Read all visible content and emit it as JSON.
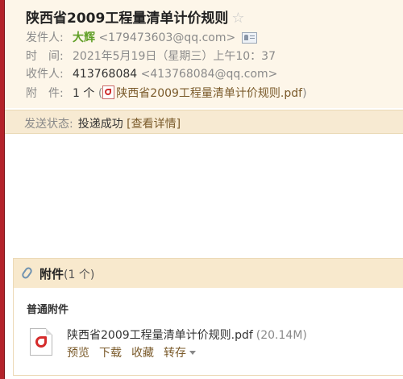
{
  "email": {
    "subject": "陕西省2009工程量清单计价规则",
    "star_icon": "star-icon",
    "from": {
      "label": "发件人:",
      "name": "大辉",
      "address": "<179473603@qq.com>"
    },
    "time": {
      "label": "时　间:",
      "value": "2021年5月19日（星期三）上午10：37"
    },
    "to": {
      "label": "收件人:",
      "name": "413768084",
      "address": "<413768084@qq.com>"
    },
    "attachment_line": {
      "label": "附　件:",
      "count": "1 个",
      "open": "(",
      "file": "陕西省2009工程量清单计价规则.pdf",
      "close": ")"
    }
  },
  "status": {
    "label": "发送状态:",
    "value": "投递成功",
    "link": "[查看详情]"
  },
  "attachments": {
    "title": "附件",
    "count": "(1 个)",
    "section": "普通附件",
    "files": [
      {
        "name": "陕西省2009工程量清单计价规则.pdf",
        "size": "(20.14M)",
        "actions": {
          "preview": "预览",
          "download": "下载",
          "favorite": "收藏",
          "forward": "转存"
        }
      }
    ]
  },
  "colors": {
    "accent_bar": "#b3222a",
    "header_bg": "#fdf6e9",
    "status_bg": "#f7ead2",
    "link": "#7a5a2a",
    "sender_name": "#5f9e25"
  }
}
